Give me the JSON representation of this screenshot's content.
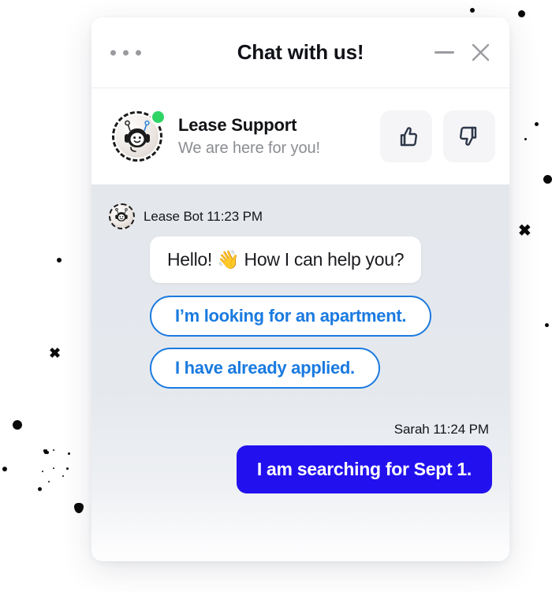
{
  "theme": {
    "accent_blue": "#1a7ae0",
    "user_bubble_blue": "#2211ee",
    "online_green": "#2fd465",
    "chat_bg": "#e5e9ee",
    "icon_slate": "#2d3748"
  },
  "titlebar": {
    "menu_icon": "three-dots-icon",
    "title": "Chat with us!",
    "minimize_icon": "minimize-icon",
    "close_icon": "close-icon"
  },
  "agent_header": {
    "avatar_icon": "robot-avatar",
    "status": "online",
    "name": "Lease Support",
    "tagline": "We are here for you!",
    "thumbs_up_icon": "thumbs-up-icon",
    "thumbs_down_icon": "thumbs-down-icon"
  },
  "conversation": {
    "messages": [
      {
        "sender": "Lease Bot",
        "time": "11:23 PM",
        "meta": "Lease Bot 11:23 PM",
        "text": "Hello! 👋 How I can help you?",
        "side": "left"
      },
      {
        "sender": "Sarah",
        "time": "11:24 PM",
        "meta": "Sarah 11:24 PM",
        "text": "I am searching for Sept 1.",
        "side": "right"
      }
    ],
    "quick_replies": [
      {
        "label": "I’m looking for an apartment."
      },
      {
        "label": "I have already applied."
      }
    ]
  }
}
